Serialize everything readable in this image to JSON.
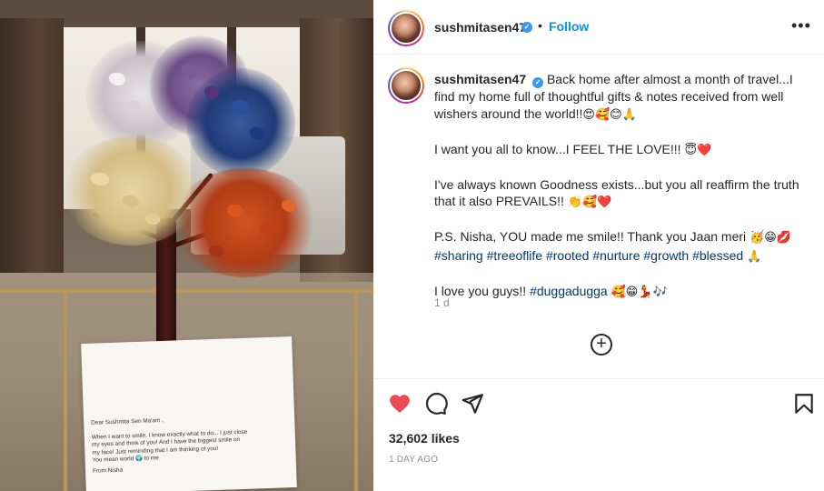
{
  "colors": {
    "accent": "#0095f6",
    "heart": "#ed4956",
    "verified": "#3897f0",
    "hashtag": "#00376b",
    "muted": "#8e8e8e"
  },
  "header": {
    "username": "sushmitasen47",
    "verified_icon": "check",
    "separator": "•",
    "follow_label": "Follow",
    "more_icon": "•••"
  },
  "photo": {
    "note": {
      "greeting": "Dear Sushmita  Sen Ma'am ,",
      "line1": "When I want to smile, I know exactly what to do... I just close",
      "line2": "my eyes and think of you! And I have the biggest smile on",
      "line3": "my face! Just reminding that I am thinking of you!",
      "line4": "You mean world 🌍 to me",
      "sign": "From Nisha"
    }
  },
  "caption": {
    "username": "sushmitasen47",
    "p1_text": "Back home after almost a month of travel...I find my home full of thoughtful gifts & notes received from well wishers around the world!!",
    "p1_emoji": "😍🥰😊🙏",
    "p2_text": "I want you all to know...I FEEL THE LOVE!!!",
    "p2_emoji": "😇❤️",
    "p3_text": "I've always known Goodness exists...but you all reaffirm the truth that it also PREVAILS!!",
    "p3_emoji": "👏🥰❤️",
    "p4_text": "P.S. Nisha, YOU made me smile!! Thank you Jaan meri",
    "p4_emoji": "🥳😁💋",
    "p4_hashtags": [
      "#sharing",
      "#treeoflife",
      "#rooted",
      "#nurture",
      "#growth",
      "#blessed"
    ],
    "p4_tail_emoji": "🙏",
    "p5_text": "I love you guys!!",
    "p5_hashtag": "#duggadugga",
    "p5_emoji": "🥰😁💃🎶",
    "time": "1 d",
    "add_comment_icon": "+"
  },
  "actions": {
    "like_icon": "heart-filled",
    "comment_icon": "comment",
    "share_icon": "paper-plane",
    "save_icon": "bookmark",
    "likes": "32,602 likes",
    "date": "1 DAY AGO"
  }
}
